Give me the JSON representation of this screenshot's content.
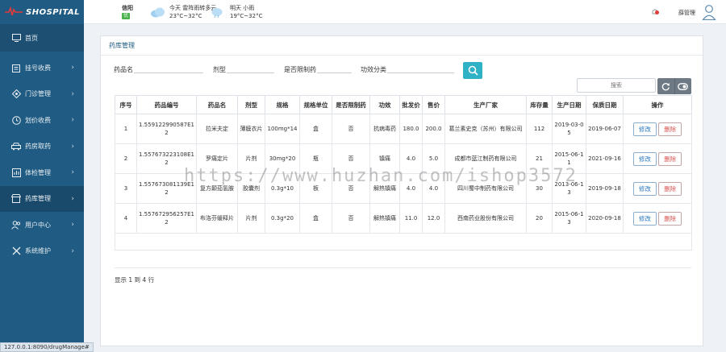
{
  "app": {
    "logo_text": "SHOSPITAL"
  },
  "sidebar": {
    "items": [
      {
        "label": "首页",
        "icon": "monitor-icon"
      },
      {
        "label": "挂号收费",
        "icon": "clipboard-icon"
      },
      {
        "label": "门诊管理",
        "icon": "diamond-icon"
      },
      {
        "label": "划价收费",
        "icon": "clock-icon"
      },
      {
        "label": "药房取药",
        "icon": "car-icon"
      },
      {
        "label": "体检管理",
        "icon": "bars-icon"
      },
      {
        "label": "药库管理",
        "icon": "shop-icon"
      },
      {
        "label": "用户中心",
        "icon": "users-icon"
      },
      {
        "label": "系统维护",
        "icon": "tools-icon"
      }
    ]
  },
  "topbar": {
    "city": "信阳",
    "aqi": "优",
    "today": {
      "line1": "今天  雷阵雨转多云",
      "line2": "23°C~32°C"
    },
    "tomorrow": {
      "line1": "明天  小雨",
      "line2": "19°C~32°C"
    },
    "user": "薛管理"
  },
  "panel": {
    "title": "药库管理"
  },
  "filters": {
    "name_label": "药品名",
    "type_label": "剂型",
    "restricted_label": "是否限制药",
    "effect_label": "功效分类"
  },
  "toolbar": {
    "search_placeholder": "搜索"
  },
  "table": {
    "headers": [
      "序号",
      "药品编号",
      "药品名",
      "剂型",
      "规格",
      "规格单位",
      "是否限制药",
      "功效",
      "批发价",
      "售价",
      "生产厂家",
      "库存量",
      "生产日期",
      "保质日期",
      "操作"
    ],
    "rows": [
      [
        "1",
        "1.559122990587E12",
        "拉米夫定",
        "薄膜衣片",
        "100mg*14",
        "盒",
        "否",
        "抗病毒药",
        "180.0",
        "200.0",
        "葛兰素史克（苏州）有限公司",
        "112",
        "2019-03-05",
        "2019-06-07"
      ],
      [
        "2",
        "1.557673223108E12",
        "罗痛定片",
        "片剂",
        "30mg*20",
        "瓶",
        "否",
        "镇痛",
        "4.0",
        "5.0",
        "成都市蓝江制药有限公司",
        "21",
        "2015-06-11",
        "2021-09-16"
      ],
      [
        "3",
        "1.557673081139E12",
        "复方颠茄氢胺",
        "胶囊剂",
        "0.3g*10",
        "板",
        "否",
        "解热镇痛",
        "4.0",
        "4.0",
        "四川蜀中制药有限公司",
        "30",
        "2013-06-13",
        "2019-09-18"
      ],
      [
        "4",
        "1.557672956257E12",
        "布洛芬缓释片",
        "片剂",
        "0.3g*20",
        "盒",
        "否",
        "解热镇痛",
        "11.0",
        "12.0",
        "西南药业股份有限公司",
        "20",
        "2015-06-13",
        "2020-09-18"
      ]
    ],
    "edit_label": "修改",
    "delete_label": "删除"
  },
  "summary": "显示 1 到 4 行",
  "status_url": "127.0.0.1:8090/drugManage#",
  "watermark": "https://www.huzhan.com/ishop3572"
}
